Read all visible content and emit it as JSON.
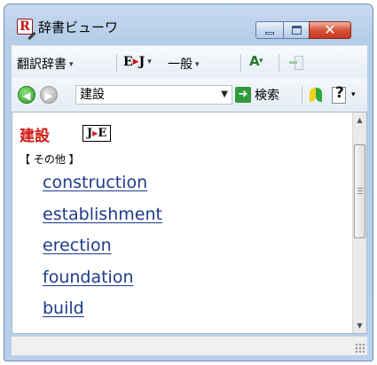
{
  "window": {
    "title": "辞書ビューワ",
    "close_glyph": "✕"
  },
  "toolbar1": {
    "dictionary_menu": "翻訳辞書",
    "direction_menu": {
      "left": "E",
      "right": "J"
    },
    "field_menu": "一般",
    "menu_arrow": "▾"
  },
  "toolbar2": {
    "search_value": "建設",
    "search_button": "検索",
    "back_glyph": "◀",
    "forward_glyph": "▶",
    "go_glyph": "➜"
  },
  "entry": {
    "headword": "建設",
    "direction_badge": {
      "left": "J",
      "right": "E"
    },
    "part_of_speech": "【 その他 】",
    "translations": [
      "construction",
      "establishment",
      "erection",
      "foundation",
      "build"
    ]
  },
  "scrollbar": {
    "up_glyph": "▲",
    "down_glyph": "▼"
  },
  "colors": {
    "headword": "#d11a14",
    "translation_link": "#1f3a8a",
    "window_frame": "#b9d0ea"
  },
  "icons": [
    "app-dictionary-icon",
    "minimize-icon",
    "maximize-icon",
    "close-icon",
    "font-icon",
    "exit-icon",
    "back-icon",
    "forward-icon",
    "search-go-icon",
    "beginner-mark-icon",
    "help-icon",
    "resize-grip-icon"
  ]
}
